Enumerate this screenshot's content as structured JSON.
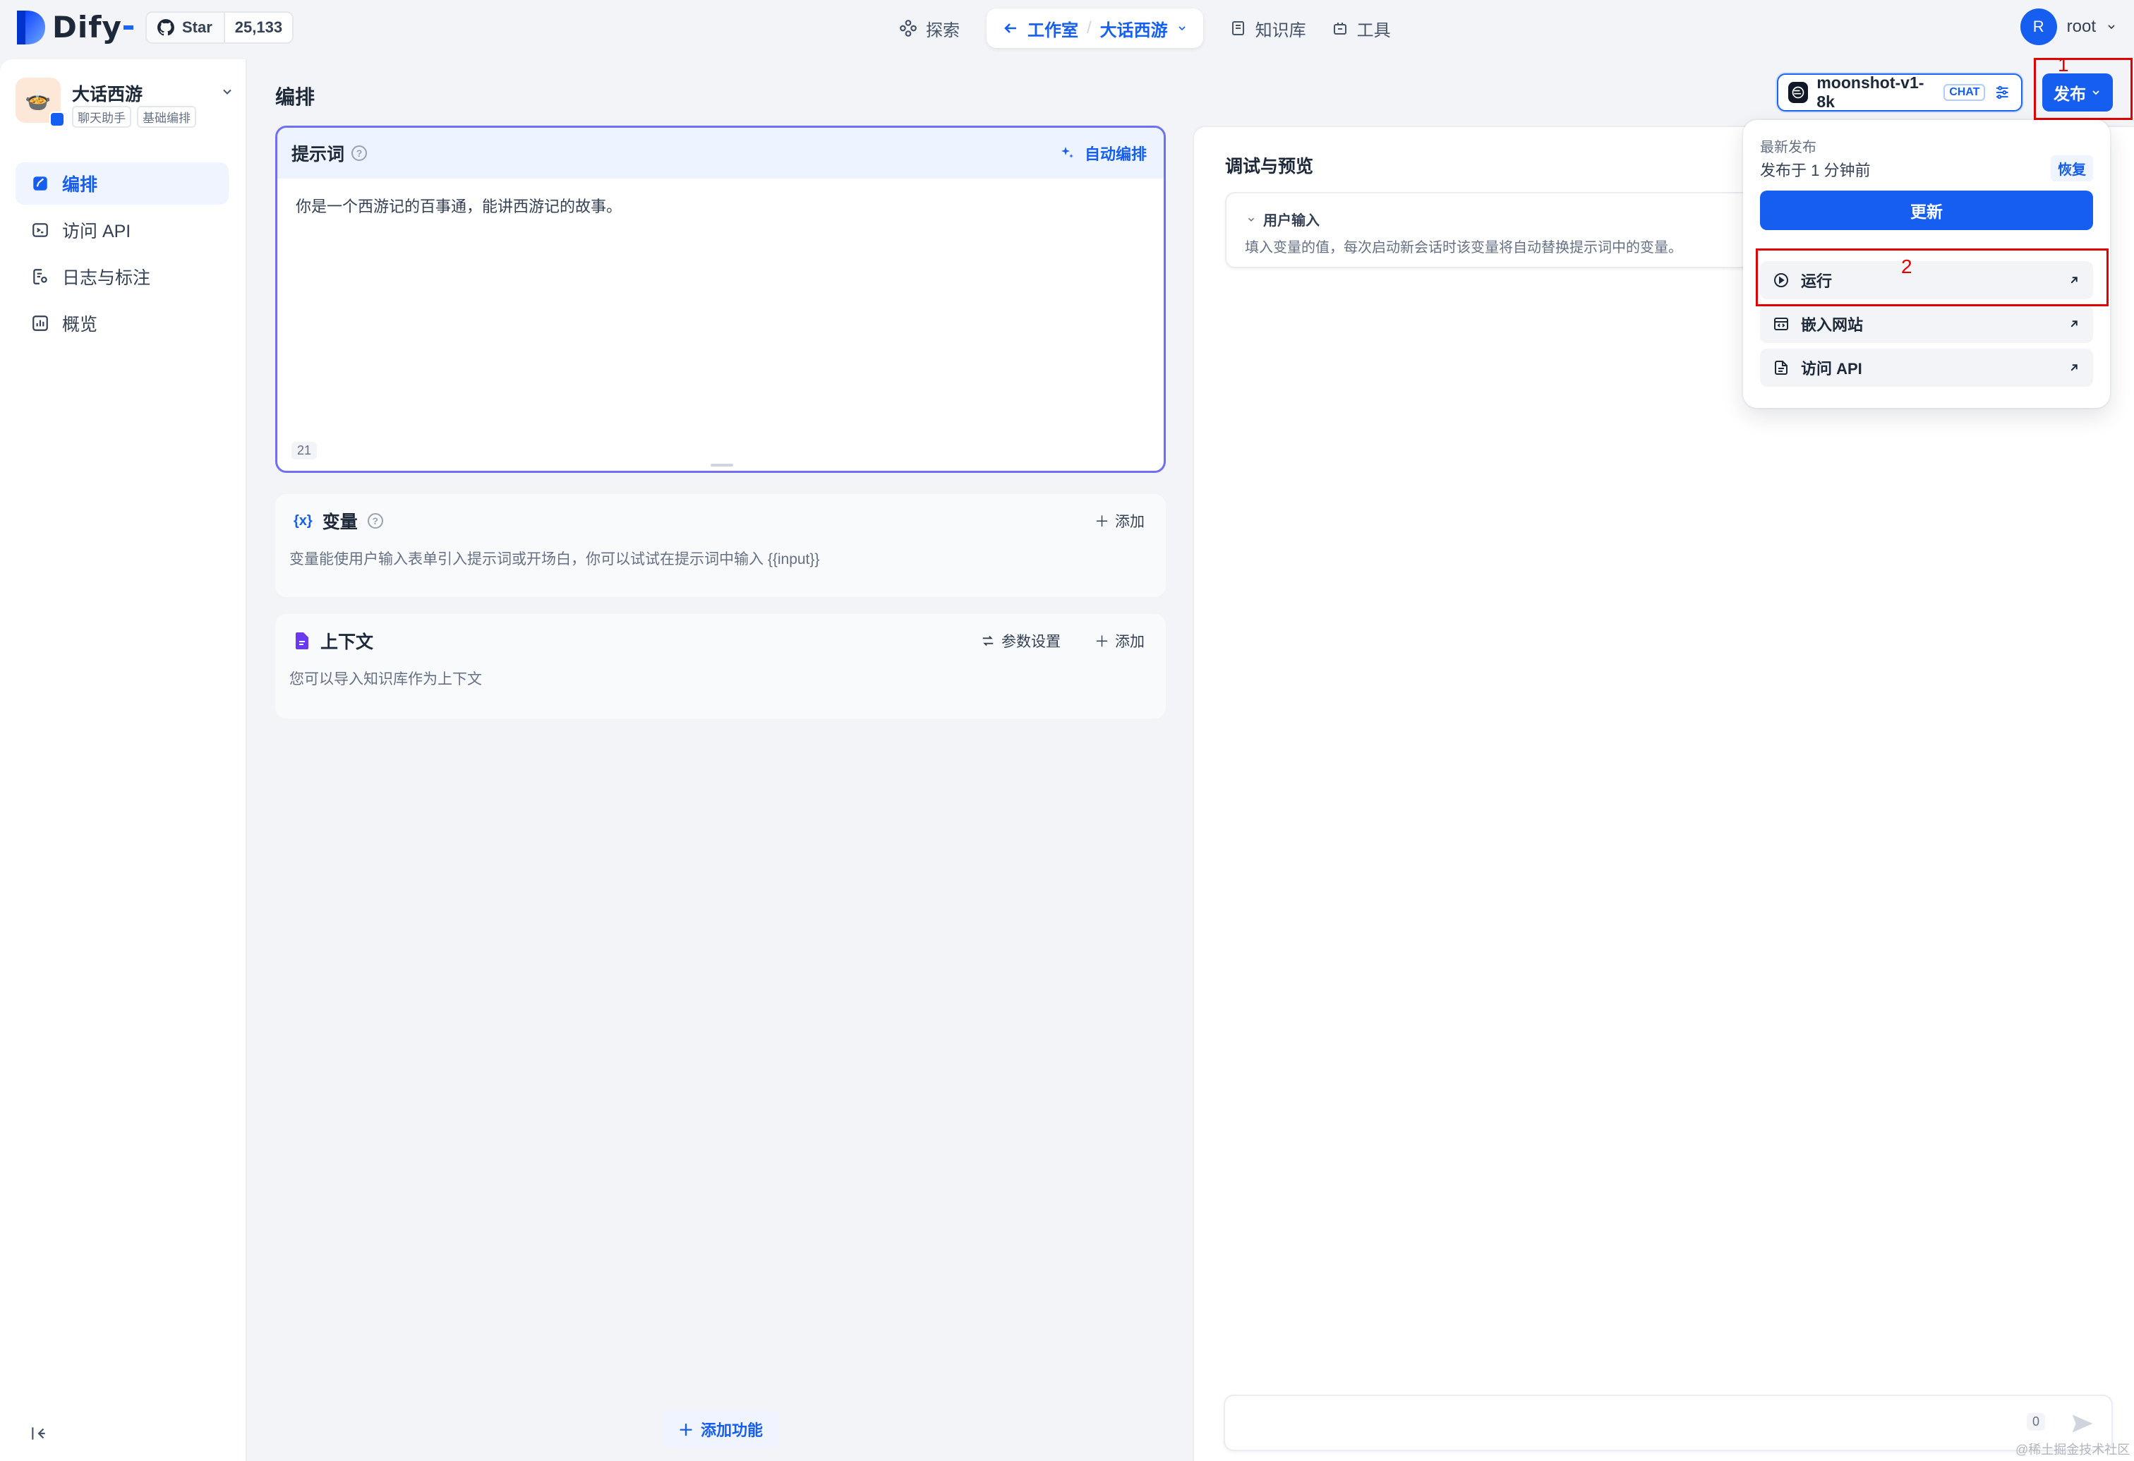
{
  "brand": {
    "name": "Dify"
  },
  "github": {
    "star_label": "Star",
    "star_count": "25,133"
  },
  "nav": {
    "explore": "探索",
    "studio": "工作室",
    "app_name": "大话西游",
    "knowledge": "知识库",
    "tools": "工具"
  },
  "user": {
    "avatar_letter": "R",
    "name": "root"
  },
  "sidebar": {
    "app_name": "大话西游",
    "tags": [
      "聊天助手",
      "基础编排"
    ],
    "items": [
      {
        "label": "编排",
        "icon": "orchestrate-icon",
        "active": true
      },
      {
        "label": "访问 API",
        "icon": "terminal-icon",
        "active": false
      },
      {
        "label": "日志与标注",
        "icon": "log-icon",
        "active": false
      },
      {
        "label": "概览",
        "icon": "chart-icon",
        "active": false
      }
    ]
  },
  "header": {
    "title": "编排",
    "model_name": "moonshot-v1-8k",
    "model_badge": "CHAT",
    "publish_label": "发布"
  },
  "prompt": {
    "title": "提示词",
    "auto_label": "自动编排",
    "text": "你是一个西游记的百事通，能讲西游记的故事。",
    "char_count": "21"
  },
  "variables": {
    "title": "变量",
    "add_label": "添加",
    "description": "变量能使用户输入表单引入提示词或开场白，你可以试试在提示词中输入 {{input}}"
  },
  "context": {
    "title": "上下文",
    "settings_label": "参数设置",
    "add_label": "添加",
    "description": "您可以导入知识库作为上下文"
  },
  "add_feature_label": "添加功能",
  "debug": {
    "title": "调试与预览",
    "user_input_title": "用户输入",
    "user_input_desc": "填入变量的值，每次启动新会话时该变量将自动替换提示词中的变量。",
    "chat_count": "0"
  },
  "publish_menu": {
    "latest_label": "最新发布",
    "published_time": "发布于 1 分钟前",
    "restore_label": "恢复",
    "update_label": "更新",
    "items": [
      {
        "label": "运行",
        "icon": "play-icon"
      },
      {
        "label": "嵌入网站",
        "icon": "embed-icon"
      },
      {
        "label": "访问 API",
        "icon": "document-icon"
      }
    ]
  },
  "annotations": {
    "marker_1": "1",
    "marker_2": "2"
  },
  "watermark": "@稀土掘金技术社区",
  "colors": {
    "primary": "#155eef",
    "annotation": "#e00000",
    "prompt_border": "#6f6ff2"
  }
}
